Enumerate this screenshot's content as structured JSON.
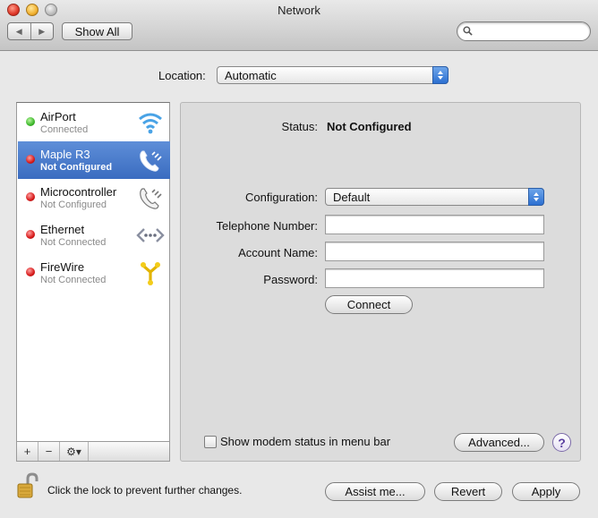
{
  "window": {
    "title": "Network"
  },
  "toolbar": {
    "back_icon": "back-arrow-icon",
    "forward_icon": "forward-arrow-icon",
    "show_all_label": "Show All",
    "search_value": ""
  },
  "location": {
    "label": "Location:",
    "selected": "Automatic"
  },
  "services": [
    {
      "name": "AirPort",
      "status": "Connected",
      "indicator": "green",
      "icon": "wifi-icon"
    },
    {
      "name": "Maple R3",
      "status": "Not Configured",
      "indicator": "red",
      "icon": "modem-phone-icon",
      "selected": true
    },
    {
      "name": "Microcontroller",
      "status": "Not Configured",
      "indicator": "red",
      "icon": "modem-phone-icon"
    },
    {
      "name": "Ethernet",
      "status": "Not Connected",
      "indicator": "red",
      "icon": "ethernet-icon"
    },
    {
      "name": "FireWire",
      "status": "Not Connected",
      "indicator": "red",
      "icon": "firewire-icon"
    }
  ],
  "list_controls": {
    "add": "+",
    "remove": "−",
    "gear": "⚙▾"
  },
  "detail": {
    "status_label": "Status:",
    "status_value": "Not Configured",
    "configuration_label": "Configuration:",
    "configuration_value": "Default",
    "telephone_label": "Telephone Number:",
    "telephone_value": "",
    "account_label": "Account Name:",
    "account_value": "",
    "password_label": "Password:",
    "password_value": "",
    "connect_label": "Connect",
    "modem_status_label": "Show modem status in menu bar",
    "modem_status_checked": false,
    "advanced_label": "Advanced...",
    "help_label": "?"
  },
  "footer": {
    "lock_text": "Click the lock to prevent further changes.",
    "assist_label": "Assist me...",
    "revert_label": "Revert",
    "apply_label": "Apply"
  },
  "colors": {
    "selection": "#3a6cc0",
    "indicator_green": "#3cb72a",
    "indicator_red": "#d61919",
    "popup_accent": "#2c6fd1"
  }
}
